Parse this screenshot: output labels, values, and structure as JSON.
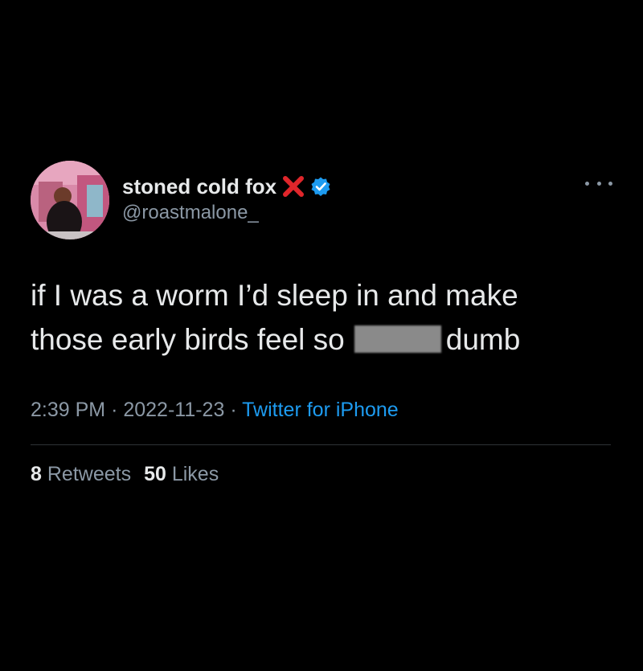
{
  "tweet": {
    "display_name": "stoned cold fox",
    "handle": "@roastmalone_",
    "name_emoji": "cross-mark-icon",
    "verified_icon": "verified-badge-icon",
    "text_line1": "if I was a worm I’d sleep in and make",
    "text_line2_start": "those early birds feel so",
    "text_line2_end": "dumb",
    "time": "2:39 PM",
    "separator": "·",
    "date": "2022-11-23",
    "source": "Twitter for iPhone",
    "retweets_count": "8",
    "retweets_label": "Retweets",
    "likes_count": "50",
    "likes_label": "Likes"
  },
  "colors": {
    "background": "#000000",
    "text": "#e7e9ea",
    "muted": "#8b98a5",
    "link": "#1d9bf0",
    "cross": "#e0262b"
  }
}
